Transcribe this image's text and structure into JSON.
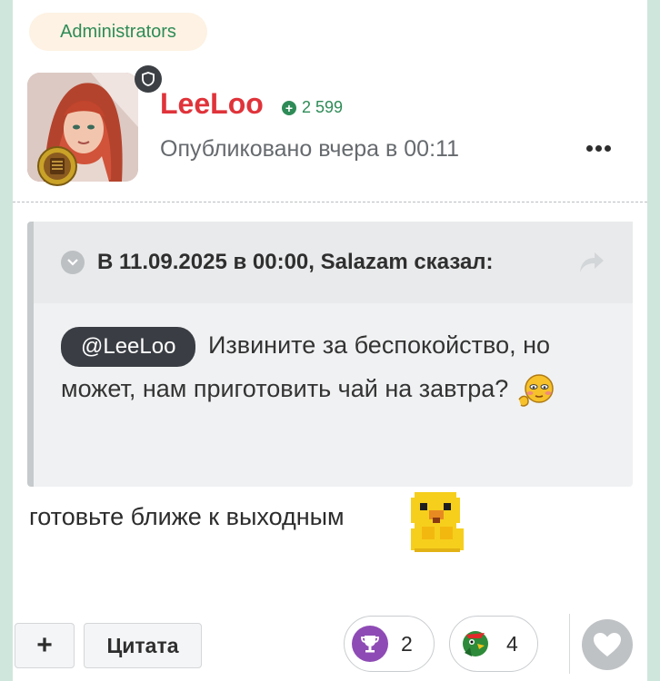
{
  "author": {
    "group_badge": "Administrators",
    "username": "LeeLoo",
    "reputation": "2 599",
    "posted": "Опубликовано вчера в 00:11",
    "username_color": "#e0333a"
  },
  "quote": {
    "citation": "В 11.09.2025 в 00:00, Salazam сказал:",
    "mention": "@LeeLoo",
    "text": "Извините за беспокойство, но может, нам приготовить чай на завтра?"
  },
  "reply": {
    "text": "готовьте ближе к выходным"
  },
  "actions": {
    "plus_label": "+",
    "quote_label": "Цитата"
  },
  "reactions": [
    {
      "icon": "trophy-icon",
      "count": "2",
      "color": "#8e4bb5"
    },
    {
      "icon": "parrot-icon",
      "count": "4",
      "color": "#2e8b3a"
    }
  ],
  "colors": {
    "accent_green": "#2e8b57",
    "background": "#cfe6dc"
  }
}
